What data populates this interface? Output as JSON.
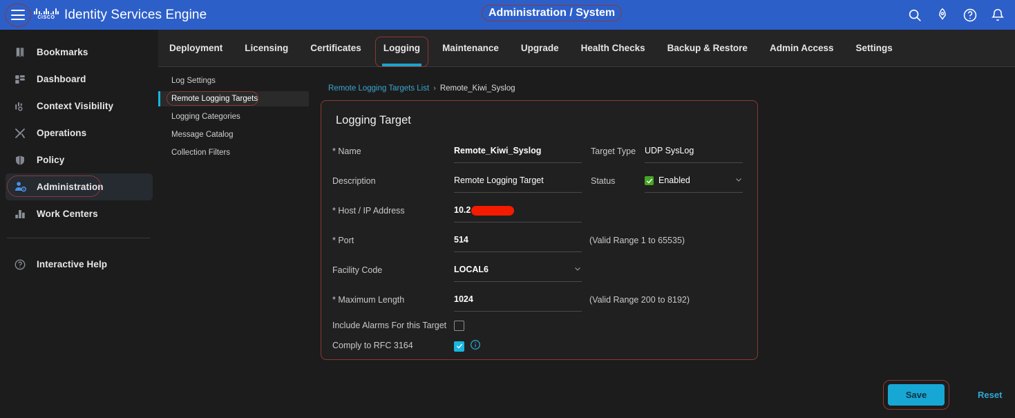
{
  "header": {
    "app_title": "Identity Services Engine",
    "brand": "CISCO",
    "context": "Administration / System",
    "menu_icon": "hamburger-icon",
    "icons": [
      {
        "name": "search-icon",
        "label": "Search"
      },
      {
        "name": "rocket-icon",
        "label": "Quick Launch"
      },
      {
        "name": "help-icon",
        "label": "Help"
      },
      {
        "name": "notifications-icon",
        "label": "Notifications"
      }
    ],
    "accent_blue": "#2d5fc9"
  },
  "sidebar": {
    "items": [
      {
        "label": "Bookmarks",
        "icon": "bookmark-icon",
        "active": false
      },
      {
        "label": "Dashboard",
        "icon": "dashboard-icon",
        "active": false
      },
      {
        "label": "Context Visibility",
        "icon": "context-visibility-icon",
        "active": false
      },
      {
        "label": "Operations",
        "icon": "operations-icon",
        "active": false
      },
      {
        "label": "Policy",
        "icon": "policy-icon",
        "active": false
      },
      {
        "label": "Administration",
        "icon": "administration-icon",
        "active": true
      },
      {
        "label": "Work Centers",
        "icon": "work-centers-icon",
        "active": false
      }
    ],
    "help": {
      "label": "Interactive Help",
      "icon": "question-circle-icon"
    }
  },
  "tabs": [
    {
      "label": "Deployment",
      "active": false
    },
    {
      "label": "Licensing",
      "active": false
    },
    {
      "label": "Certificates",
      "active": false
    },
    {
      "label": "Logging",
      "active": true
    },
    {
      "label": "Maintenance",
      "active": false
    },
    {
      "label": "Upgrade",
      "active": false
    },
    {
      "label": "Health Checks",
      "active": false
    },
    {
      "label": "Backup & Restore",
      "active": false
    },
    {
      "label": "Admin Access",
      "active": false
    },
    {
      "label": "Settings",
      "active": false
    }
  ],
  "subnav": {
    "items": [
      {
        "label": "Log Settings",
        "active": false
      },
      {
        "label": "Remote Logging Targets",
        "active": true
      },
      {
        "label": "Logging Categories",
        "active": false
      },
      {
        "label": "Message Catalog",
        "active": false
      },
      {
        "label": "Collection Filters",
        "active": false
      }
    ]
  },
  "breadcrumb": {
    "parent": "Remote Logging Targets List",
    "separator": "›",
    "current": "Remote_Kiwi_Syslog"
  },
  "panel": {
    "title": "Logging Target",
    "fields": {
      "name_label": "* Name",
      "name_value": "Remote_Kiwi_Syslog",
      "target_type_label": "Target Type",
      "target_type_value": "UDP SysLog",
      "description_label": "Description",
      "description_value": "Remote Logging Target",
      "status_label": "Status",
      "status_value": "Enabled",
      "host_label": "* Host / IP Address",
      "host_value": "10.2",
      "host_redacted": true,
      "port_label": "* Port",
      "port_value": "514",
      "port_hint": "(Valid Range 1 to 65535)",
      "facility_label": "Facility Code",
      "facility_value": "LOCAL6",
      "maxlen_label": "* Maximum Length",
      "maxlen_value": "1024",
      "maxlen_hint": "(Valid Range 200 to 8192)",
      "include_alarms_label": "Include Alarms For this Target",
      "include_alarms_checked": false,
      "rfc_label": "Comply to RFC 3164",
      "rfc_checked": true
    }
  },
  "footer": {
    "save_label": "Save",
    "reset_label": "Reset"
  },
  "colors": {
    "header_blue": "#2d5fc9",
    "accent_cyan": "#17a7d4",
    "active_underline": "#1ba4cc",
    "status_green": "#45a625",
    "redaction_red": "#f41b00",
    "annotation_red": "#8a3a34"
  }
}
